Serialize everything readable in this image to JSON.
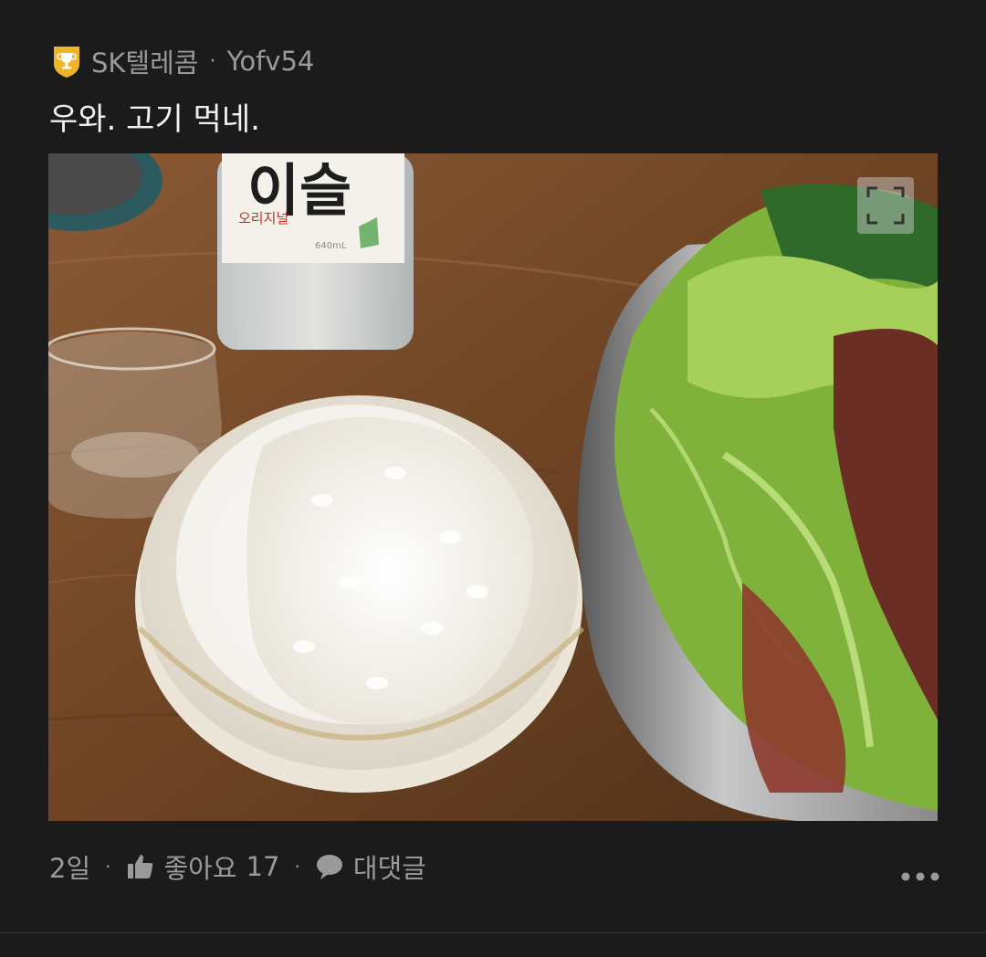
{
  "post": {
    "author": "SK텔레콤",
    "separator": "·",
    "user_id": "Yofv54",
    "title": "우와. 고기 먹네.",
    "age": "2일",
    "like_label": "좋아요",
    "like_count": "17",
    "reply_label": "대댓글"
  },
  "photo": {
    "bottle_label_text": "이슬",
    "bottle_sub_text": "오리지널",
    "bottle_volume": "640mL"
  },
  "icons": {
    "badge": "trophy-badge-icon",
    "like": "thumbs-up-icon",
    "reply": "speech-bubble-icon",
    "more": "more-dots-icon",
    "expand": "fullscreen-icon"
  },
  "colors": {
    "background": "#1b1b1b",
    "title": "#f1f1f1",
    "meta": "#9a9a9a",
    "badge": "#f0b429"
  }
}
